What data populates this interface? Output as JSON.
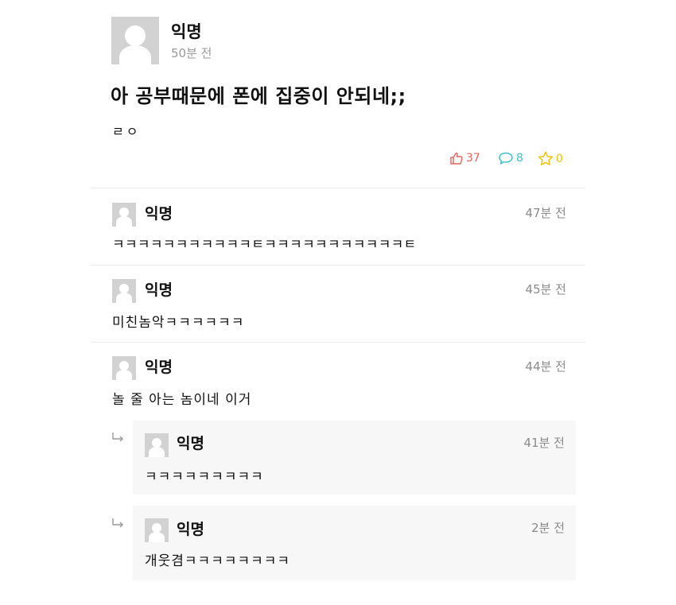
{
  "post": {
    "author": "익명",
    "time": "50분 전",
    "title": "아 공부때문에 폰에 집중이 안되네;;",
    "body": "ㄹㅇ",
    "likes": "37",
    "comments": "8",
    "scraps": "0"
  },
  "icons": {
    "like": "thumbs-up-icon",
    "comment": "speech-bubble-icon",
    "scrap": "star-icon",
    "reply": "reply-arrow-icon",
    "avatar": "default-profile-icon"
  },
  "colors": {
    "like": "#e0655c",
    "comment": "#3ec1cf",
    "scrap": "#f2c200",
    "muted": "#9a9a9a",
    "reply_bg": "#f7f7f7"
  },
  "comments": [
    {
      "author": "익명",
      "time": "47분 전",
      "text": "ㅋㅋㅋㅋㅋㅋㅋㅋㅋㅋㅋㅌㅋㅋㅋㅋㅋㅋㅋㅋㅋㅋㅋㅌ"
    },
    {
      "author": "익명",
      "time": "45분 전",
      "text": "미친놈악ㅋㅋㅋㅋㅋㅋ"
    },
    {
      "author": "익명",
      "time": "44분 전",
      "text": "놀 줄 아는 놈이네 이거"
    }
  ],
  "replies": [
    {
      "author": "익명",
      "time": "41분 전",
      "text": "ㅋㅋㅋㅋㅋㅋㅋㅋㅋ"
    },
    {
      "author": "익명",
      "time": "2분 전",
      "text": "개웃겸ㅋㅋㅋㅋㅋㅋㅋㅋ"
    }
  ]
}
